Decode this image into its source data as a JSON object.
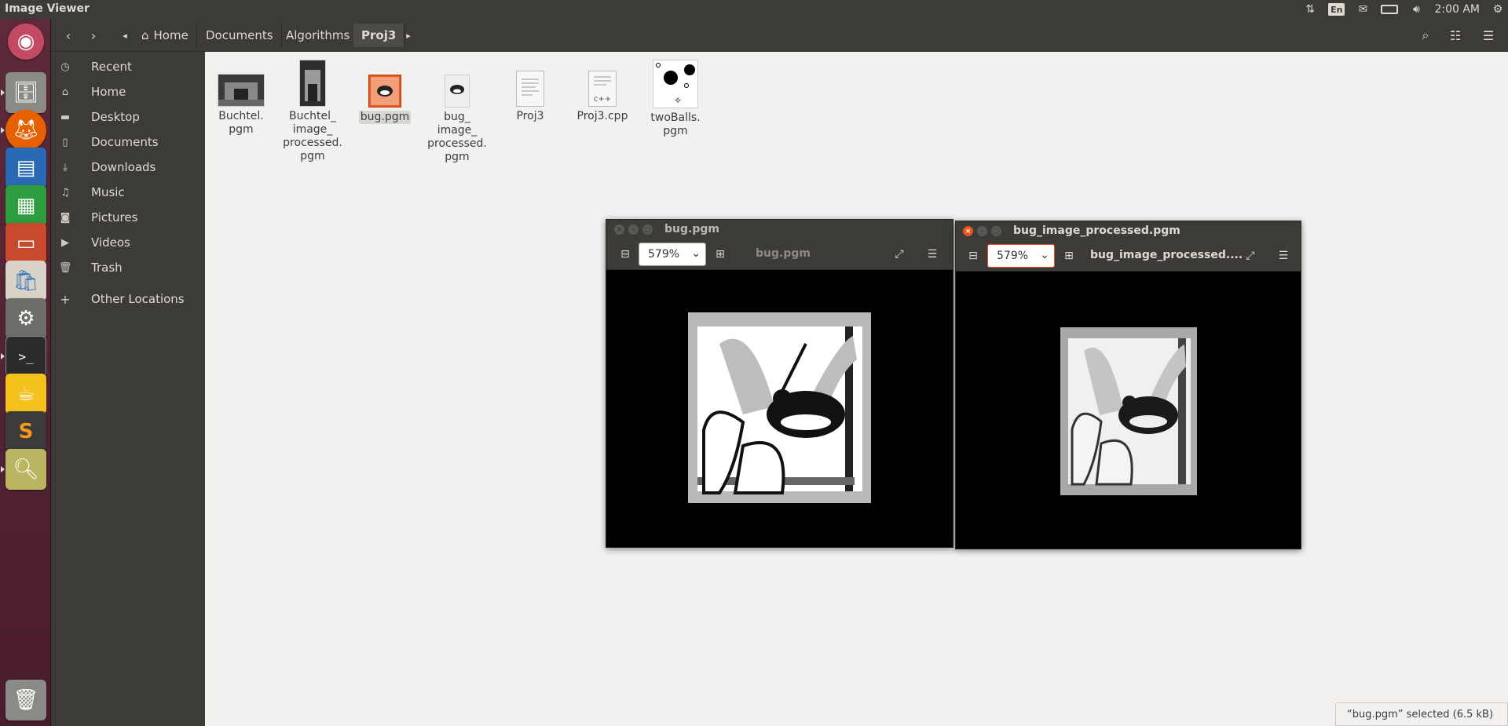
{
  "window": {
    "app_title": "Image Viewer"
  },
  "top_panel": {
    "keyboard": "En",
    "time": "2:00 AM"
  },
  "breadcrumb": [
    "Home",
    "Documents",
    "Algorithms",
    "Proj3"
  ],
  "sidebar": {
    "items": [
      "Recent",
      "Home",
      "Desktop",
      "Documents",
      "Downloads",
      "Music",
      "Pictures",
      "Videos",
      "Trash",
      "Other Locations"
    ]
  },
  "files": [
    {
      "name": "Buchtel.\npgm",
      "icon": "photo-thumbnail"
    },
    {
      "name": "Buchtel_\nimage_\nprocessed.\npgm",
      "icon": "photo-thumbnail"
    },
    {
      "name": "bug.pgm",
      "icon": "bug-thumbnail",
      "selected": true
    },
    {
      "name": "bug_\nimage_\nprocessed.\npgm",
      "icon": "bug-thumbnail"
    },
    {
      "name": "Proj3",
      "icon": "text-file-icon"
    },
    {
      "name": "Proj3.cpp",
      "icon": "cpp-file-icon",
      "badge": "c++"
    },
    {
      "name": "twoBalls.\npgm",
      "icon": "balls-thumbnail"
    }
  ],
  "viewer1": {
    "title": "bug.pgm",
    "zoom": "579%",
    "name": "bug.pgm"
  },
  "viewer2": {
    "title": "bug_image_processed.pgm",
    "zoom": "579%",
    "name": "bug_image_processed...."
  },
  "status": "“bug.pgm” selected  (6.5 kB)",
  "colors": {
    "accent": "#e9541e",
    "panel": "#3c3b37",
    "launcher": "#5c2a3a"
  }
}
